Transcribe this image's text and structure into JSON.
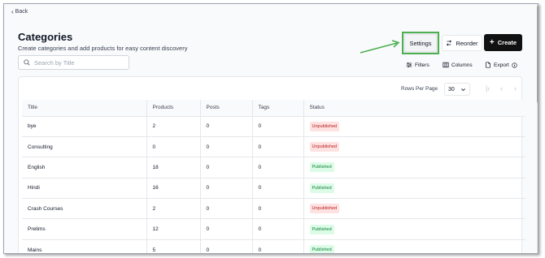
{
  "nav": {
    "back_label": "Back"
  },
  "header": {
    "title": "Categories",
    "subtitle": "Create categories and add products for easy content discovery"
  },
  "search": {
    "placeholder": "Search by Title",
    "value": ""
  },
  "actions": {
    "settings": "Settings",
    "reorder": "Reorder",
    "create": "Create"
  },
  "toolbar": {
    "filters": "Filters",
    "columns": "Columns",
    "export": "Export"
  },
  "pagination": {
    "rows_per_page_label": "Rows Per Page",
    "rows_per_page_value": "30"
  },
  "colors": {
    "highlight": "#4caf50",
    "primary": "#111111",
    "published": "#15803d",
    "unpublished": "#b91c1c"
  },
  "table": {
    "columns": [
      "Title",
      "Products",
      "Posts",
      "Tags",
      "Status"
    ],
    "rows": [
      {
        "title": "bye",
        "products": "2",
        "posts": "0",
        "tags": "0",
        "status": "Unpublished"
      },
      {
        "title": "Consulting",
        "products": "0",
        "posts": "0",
        "tags": "0",
        "status": "Unpublished"
      },
      {
        "title": "English",
        "products": "18",
        "posts": "0",
        "tags": "0",
        "status": "Published"
      },
      {
        "title": "Hindi",
        "products": "16",
        "posts": "0",
        "tags": "0",
        "status": "Published"
      },
      {
        "title": "Crash Courses",
        "products": "2",
        "posts": "0",
        "tags": "0",
        "status": "Unpublished"
      },
      {
        "title": "Prelims",
        "products": "12",
        "posts": "0",
        "tags": "0",
        "status": "Published"
      },
      {
        "title": "Mains",
        "products": "5",
        "posts": "0",
        "tags": "0",
        "status": "Published"
      }
    ]
  }
}
